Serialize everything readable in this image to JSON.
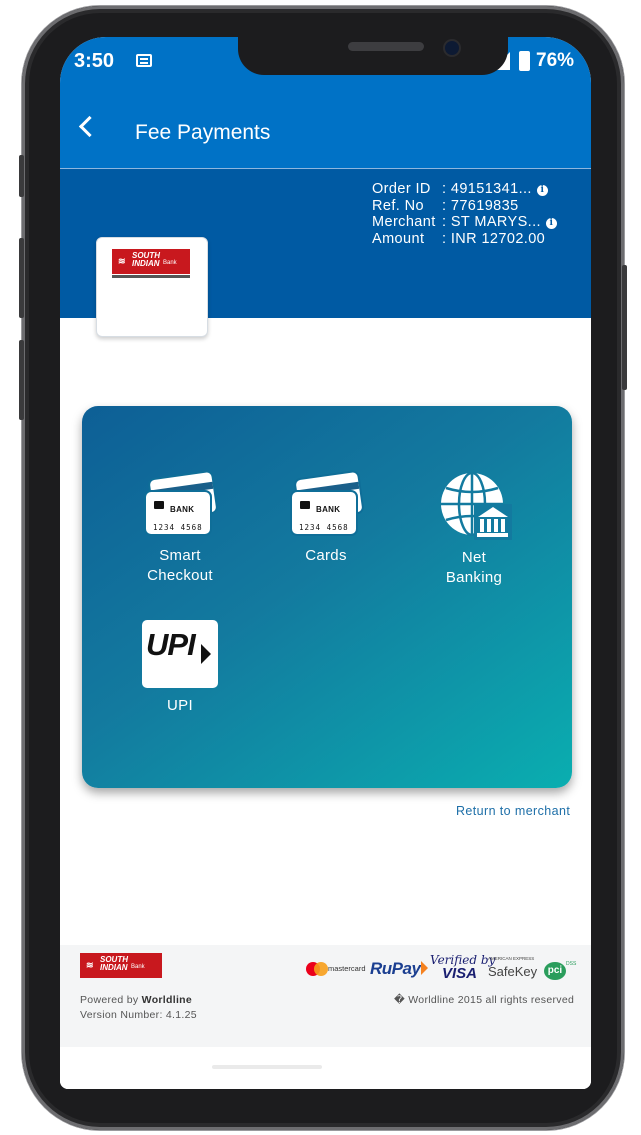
{
  "status_bar": {
    "time": "3:50",
    "battery_pct": "76%"
  },
  "app_bar": {
    "title": "Fee Payments"
  },
  "order": {
    "order_id_label": "Order ID",
    "order_id_value": ": 49151341...",
    "ref_label": "Ref. No",
    "ref_value": ": 77619835",
    "merchant_label": "Merchant",
    "merchant_value": ": ST MARYS...",
    "amount_label": "Amount",
    "amount_value": ": INR 12702.00",
    "info_glyph": "i"
  },
  "bank_logo": {
    "line1": "SOUTH",
    "line2": "INDIAN",
    "line3": "Bank"
  },
  "card_icon": {
    "bank_text": "BANK",
    "number": "1234 4568"
  },
  "payment_options": [
    {
      "label_line1": "Smart",
      "label_line2": "Checkout"
    },
    {
      "label_line1": "Cards",
      "label_line2": ""
    },
    {
      "label_line1": "Net",
      "label_line2": "Banking"
    },
    {
      "label_line1": "UPI",
      "label_line2": "",
      "logo_text": "UPI"
    }
  ],
  "links": {
    "return_to_merchant": "Return to merchant"
  },
  "footer": {
    "powered_prefix": "Powered by ",
    "powered_brand": "Worldline",
    "version": "  Version Number: 4.1.25",
    "copyright": "� Worldline 2015 all rights reserved",
    "brand_mastercard": "mastercard",
    "brand_rupay_1": "Ru",
    "brand_rupay_2": "Pay",
    "brand_verified_by": "Verified by",
    "brand_visa": "VISA",
    "brand_amex_small": "AMERICAN EXPRESS",
    "brand_safekey": "SafeKey",
    "brand_pci": "pci",
    "brand_pci_dss": "DSS"
  },
  "colors": {
    "app_bar": "#0072c6",
    "header_band": "#005aa3",
    "card_gradient_start": "#0d5f96",
    "card_gradient_end": "#0aaeb0",
    "link": "#1e6fa8",
    "bank_red": "#c8181e"
  },
  "icons": [
    "back-arrow-icon",
    "message-icon",
    "signal-icon",
    "battery-icon",
    "info-icon",
    "bank-card-icon",
    "globe-bank-icon",
    "upi-logo"
  ]
}
